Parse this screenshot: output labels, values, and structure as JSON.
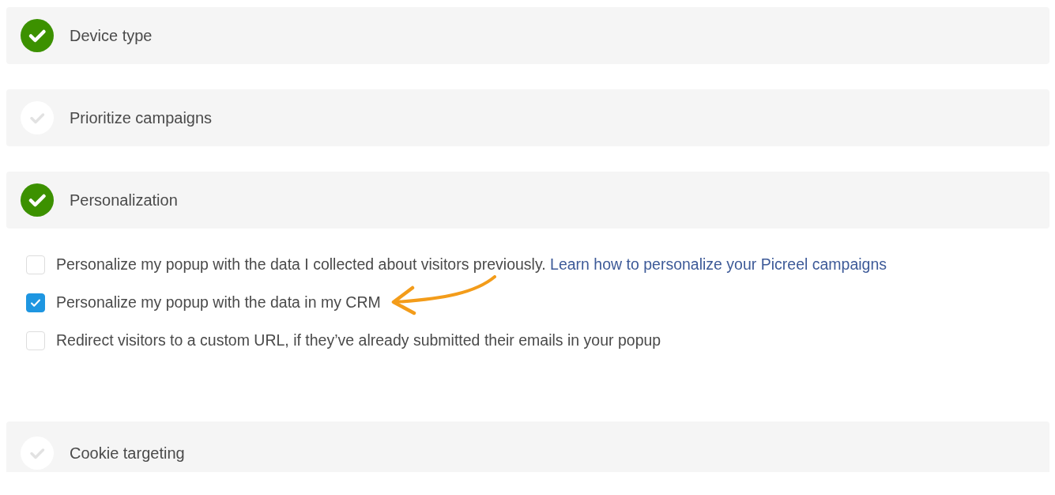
{
  "sections": [
    {
      "title": "Device type",
      "completed": true
    },
    {
      "title": "Prioritize campaigns",
      "completed": false
    },
    {
      "title": "Personalization",
      "completed": true,
      "options": [
        {
          "label": "Personalize my popup with the data I collected about visitors previously.",
          "link": "Learn how to personalize your Picreel campaigns",
          "checked": false
        },
        {
          "label": "Personalize my popup with the data in my CRM",
          "checked": true,
          "annotated": true
        },
        {
          "label": "Redirect visitors to a custom URL, if they’ve already submitted their emails in your popup",
          "checked": false
        }
      ]
    },
    {
      "title": "Cookie targeting",
      "completed": false
    }
  ]
}
